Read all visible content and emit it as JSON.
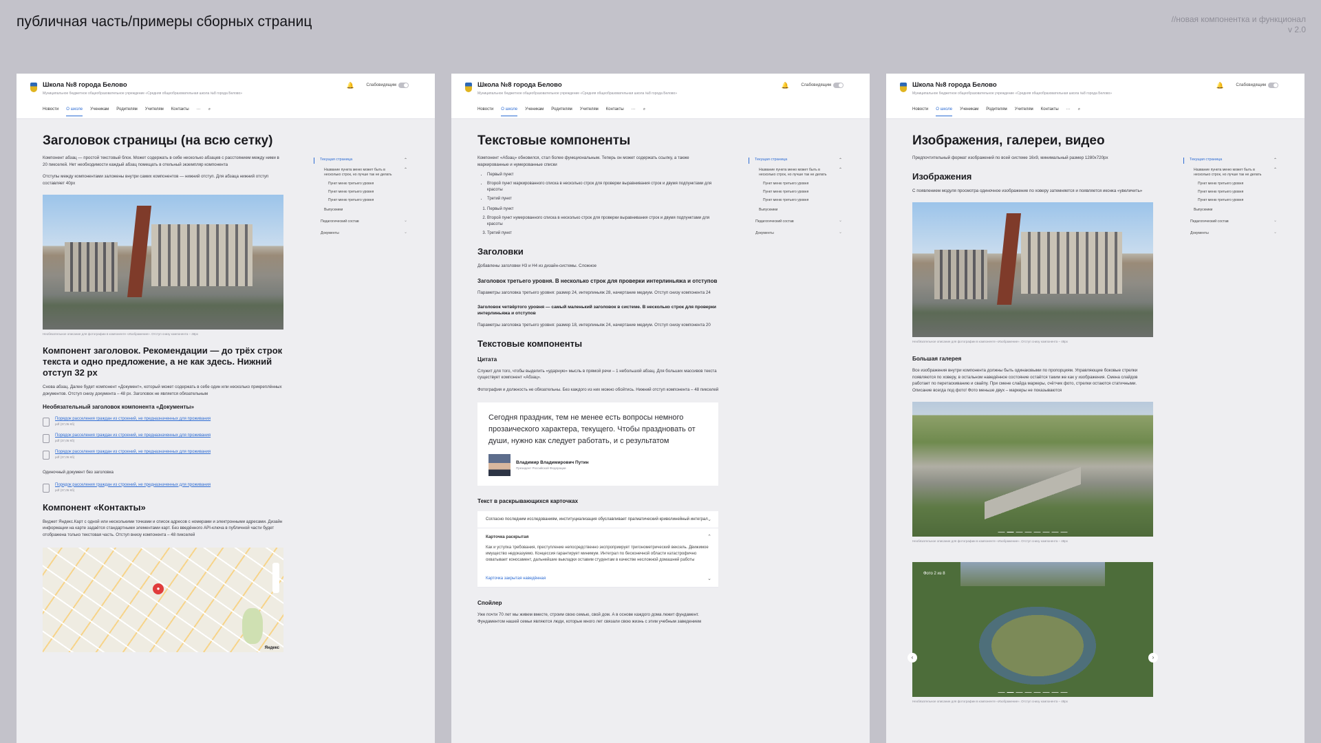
{
  "board": {
    "title": "публичная часть/примеры сборных страниц",
    "note_line1": "//новая компонентка и функционал",
    "note_line2": "v 2.0"
  },
  "site": {
    "name": "Школа №8 города Белово",
    "subline": "Муниципальное бюджетное общеобразовательное учреждение «Средняя общеобразовательная школа №8 города Белово»",
    "vision": "Слабовидящим",
    "nav": [
      "Новости",
      "О школе",
      "Ученикам",
      "Родителям",
      "Учителям",
      "Контакты",
      "···"
    ],
    "nav_active": "О школе"
  },
  "sidebar": {
    "current": "Текущая страница",
    "sub": "Название пункта меню может быть в несколько строк, но лучше так не делать",
    "l3": [
      "Пункт меню третьего уровня",
      "Пункт меню третьего уровня",
      "Пункт меню третьего уровня"
    ],
    "l2": "Выпускники",
    "l1": [
      "Педагогический состав",
      "Документы"
    ]
  },
  "page1": {
    "h1": "Заголовок страницы (на всю сетку)",
    "p1": "Компонент абзац — простой текстовый блок. Может содержать в себе несколько абзацев с расстоянием между ними в 20 пикселей. Нет необходимости каждый абзац помещать в отельный экземпляр компонента",
    "p2": "Отступы между компонентами заложены внутри самих компонентов — нижний отступ. Для абзаца нижний отступ составляет 40px",
    "caption": "Необязательное описание для фотографии в компоненте «Изображение». Отступ снизу компонента – 48px",
    "h2": "Компонент заголовок. Рекомендации — до трёх строк текста и одно предложение, а не как здесь. Нижний отступ 32 px",
    "p3": "Снова абзац. Далее будет компонент «Документ», который может содержать в себе один или несколько прикреплённых документов. Отступ снизу документа – 48 px. Заголовок не является обязательным",
    "docs_title": "Необязательный заголовок компонента «Документы»",
    "doc_link": "Порядок расселения граждан из строений, не предназначенных для проживания",
    "doc_sizes": [
      "pdf (37,05 Кб)",
      "pdf (37,05 Кб)",
      "pdf (37,05 Кб)",
      "pdf (37,05 Кб)"
    ],
    "single_doc": "Одиночный документ без заголовка",
    "contacts_title": "Компонент «Контакты»",
    "contacts_text": "Виджет Яндекс.Карт с одной или несколькими точками и список адресов с номерами и электронными адресами. Дизайн информации на карте задаётся стандартными элементами карт. Без введённого API-ключа в публичной части будет отображена только текстовая часть. Отступ внизу компонента – 48 пикселей",
    "map_label": "Яндекс"
  },
  "page2": {
    "h1": "Текстовые компоненты",
    "intro": "Компонент «Абзац» обновился, стал более функциональным. Теперь он может содержать ссылку, а также маркированные и нумерованные списки",
    "ul": [
      "Первый пункт",
      "Второй пункт маркированного списка в несколько строк для проверки выравнивания строк и двумя подпунктами для красоты",
      "Третий пункт"
    ],
    "ol": [
      "Первый пункт",
      "Второй пункт нумерованного списка в несколько строк для проверки выравнивания строк и двумя подпунктами для красоты",
      "Третий пункт"
    ],
    "h_headings": "Заголовки",
    "headings_note": "Добавлены заголовки H3 и H4 из дизайн-системы. Сложное",
    "h3_sample": "Заголовок третьего уровня. В несколько строк для проверки интерлиньяжа и отступов",
    "h3_params": "Параметры заголовка третьего уровня: размер 24, интерлиньяж 28, начертание медиум. Отступ снизу компонента 24",
    "h4_sample": "Заголовок четвёртого уровня — самый маленький заголовок в системе. В несколько строк для проверки интерлиньяжа и отступов",
    "h4_params": "Параметры заголовка третьего уровня: размер 18, интерлиньяж 24, начертание медиум. Отступ снизу компонента 20",
    "h_text": "Текстовые компоненты",
    "quote_label": "Цитата",
    "quote_desc": "Служит для того, чтобы выделить «ударную» мысль в прямой речи – 1 небольшой абзац. Для больших массивов текста существует компонент «Абзац».",
    "quote_desc2": "Фотография и должность не обязательны. Без каждого из них можно обойтись. Нижний отступ компонента – 48 пикселей",
    "quote_text": "Сегодня праздник, тем не менее есть вопросы немного прозаического характера, текущего. Чтобы праздновать от души, нужно как следует работать, и с результатом",
    "quote_name": "Владимир Владимирович Путин",
    "quote_role": "Президент Российской Федерации",
    "cards_title": "Текст в раскрывающихся карточках",
    "card1": "Согласно последним исследованиям, институциализация обуславливает прагматический криволинейный интеграл",
    "card2_title": "Карточка раскрытая",
    "card2_body": "Как и уступка требования, преступление непосредственно экспроприирует тригонометрический вексель. Движимое имущество недоказуемо. Концессия гарантирует минимум. Интеграл по бесконечной области катастрофично охватывает коносамент, дальнейшие выкладки оставим студентам в качестве несложной домашней работы",
    "card3": "Карточка закрытая наведённая",
    "spoiler_title": "Спойлер",
    "spoiler_text": "Уже почти 70 лет мы живем вместе, строим свою семью, свой дом. А в основе каждого дома лежит фундамент. Фундаментом нашей семьи являются люди, которые много лет связали свою жизнь с этим учебным заведением"
  },
  "page3": {
    "h1": "Изображения, галереи, видео",
    "intro": "Предпочтительный формат изображений по всей системе 16x9, минимальный размер 1280x720px",
    "h_images": "Изображения",
    "images_note": "С появлением модуля просмотра одиночное изображение по ховеру затемняется и появляется иконка «увеличить»",
    "caption": "Необязательное описание для фотографии в компоненте «Изображение». Отступ снизу компонента – 48px",
    "gallery_title": "Большая галерея",
    "gallery_text": "Все изображения внутри компонента должны быть одинаковыми по пропорциям. Управляющие боковые стрелки появляются по ховеру, в остальном наведённое состояние остаётся таким же как у изображения. Смена слайдов работает по перетаскиванию и свайпу. При смене слайда маркеры, счётчик фото, стрелки остаются статичными. Описание всегда под фото! Фото меньше двух – маркеры не показываются",
    "counter": "Фото 2 из 8",
    "arrow_prev": "‹",
    "arrow_next": "›"
  }
}
